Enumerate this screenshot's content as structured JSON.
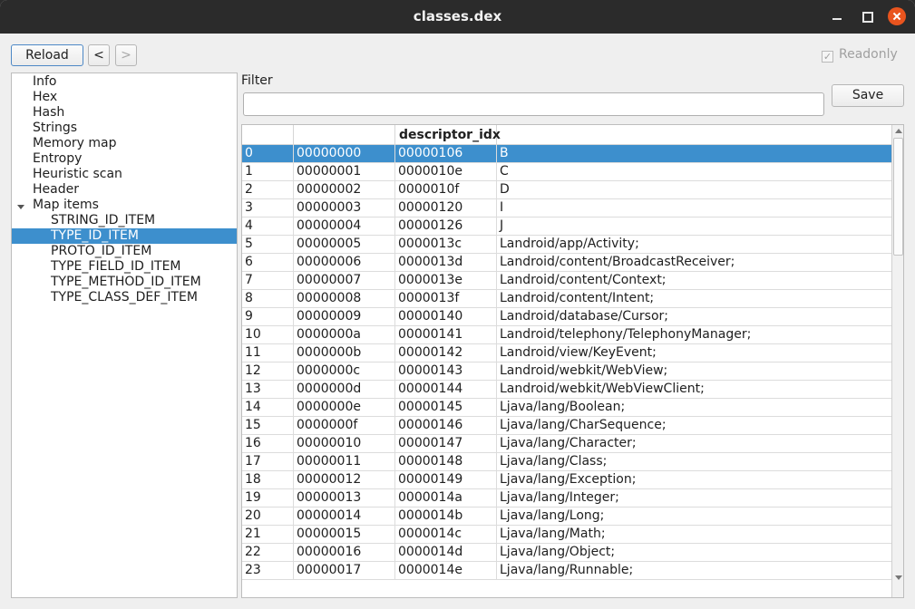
{
  "window": {
    "title": "classes.dex"
  },
  "toolbar": {
    "reload": "Reload",
    "back": "<",
    "forward": ">",
    "readonly": "Readonly",
    "readonly_check": "✓"
  },
  "tree": {
    "items": [
      "Info",
      "Hex",
      "Hash",
      "Strings",
      "Memory map",
      "Entropy",
      "Heuristic scan",
      "Header",
      "Map items"
    ],
    "children": [
      "STRING_ID_ITEM",
      "TYPE_ID_ITEM",
      "PROTO_ID_ITEM",
      "TYPE_FIELD_ID_ITEM",
      "TYPE_METHOD_ID_ITEM",
      "TYPE_CLASS_DEF_ITEM"
    ],
    "selected_child": 1
  },
  "filter": {
    "label": "Filter",
    "value": "",
    "save": "Save"
  },
  "table": {
    "columns": [
      "",
      "",
      "descriptor_idx",
      ""
    ],
    "selected_row": 0,
    "rows": [
      [
        "0",
        "00000000",
        "00000106",
        "B"
      ],
      [
        "1",
        "00000001",
        "0000010e",
        "C"
      ],
      [
        "2",
        "00000002",
        "0000010f",
        "D"
      ],
      [
        "3",
        "00000003",
        "00000120",
        "I"
      ],
      [
        "4",
        "00000004",
        "00000126",
        "J"
      ],
      [
        "5",
        "00000005",
        "0000013c",
        "Landroid/app/Activity;"
      ],
      [
        "6",
        "00000006",
        "0000013d",
        "Landroid/content/BroadcastReceiver;"
      ],
      [
        "7",
        "00000007",
        "0000013e",
        "Landroid/content/Context;"
      ],
      [
        "8",
        "00000008",
        "0000013f",
        "Landroid/content/Intent;"
      ],
      [
        "9",
        "00000009",
        "00000140",
        "Landroid/database/Cursor;"
      ],
      [
        "10",
        "0000000a",
        "00000141",
        "Landroid/telephony/TelephonyManager;"
      ],
      [
        "11",
        "0000000b",
        "00000142",
        "Landroid/view/KeyEvent;"
      ],
      [
        "12",
        "0000000c",
        "00000143",
        "Landroid/webkit/WebView;"
      ],
      [
        "13",
        "0000000d",
        "00000144",
        "Landroid/webkit/WebViewClient;"
      ],
      [
        "14",
        "0000000e",
        "00000145",
        "Ljava/lang/Boolean;"
      ],
      [
        "15",
        "0000000f",
        "00000146",
        "Ljava/lang/CharSequence;"
      ],
      [
        "16",
        "00000010",
        "00000147",
        "Ljava/lang/Character;"
      ],
      [
        "17",
        "00000011",
        "00000148",
        "Ljava/lang/Class;"
      ],
      [
        "18",
        "00000012",
        "00000149",
        "Ljava/lang/Exception;"
      ],
      [
        "19",
        "00000013",
        "0000014a",
        "Ljava/lang/Integer;"
      ],
      [
        "20",
        "00000014",
        "0000014b",
        "Ljava/lang/Long;"
      ],
      [
        "21",
        "00000015",
        "0000014c",
        "Ljava/lang/Math;"
      ],
      [
        "22",
        "00000016",
        "0000014d",
        "Ljava/lang/Object;"
      ],
      [
        "23",
        "00000017",
        "0000014e",
        "Ljava/lang/Runnable;"
      ]
    ]
  },
  "colors": {
    "accent": "#3d8fcd",
    "titlebar": "#2b2b2b",
    "close": "#e9541e"
  }
}
